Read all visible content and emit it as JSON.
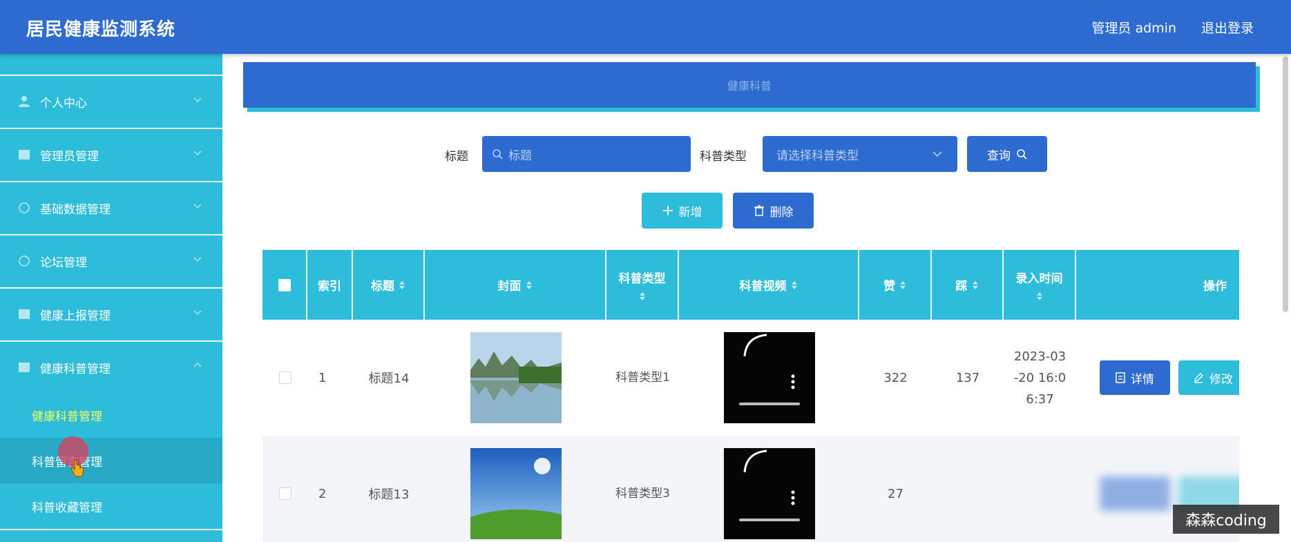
{
  "header": {
    "title": "居民健康监测系统",
    "user": "管理员 admin",
    "logout": "退出登录"
  },
  "sidebar": {
    "items": [
      {
        "label": "个人中心",
        "icon": "user-icon"
      },
      {
        "label": "管理员管理",
        "icon": "list-icon"
      },
      {
        "label": "基础数据管理",
        "icon": "circle-icon"
      },
      {
        "label": "论坛管理",
        "icon": "circle-icon"
      },
      {
        "label": "健康上报管理",
        "icon": "list-icon"
      },
      {
        "label": "健康科普管理",
        "icon": "list-icon",
        "expanded": true
      }
    ],
    "sub_items": [
      {
        "label": "健康科普管理",
        "active": true
      },
      {
        "label": "科普留言管理",
        "hovered": true
      },
      {
        "label": "科普收藏管理"
      }
    ]
  },
  "breadcrumb": {
    "current": "健康科普"
  },
  "search": {
    "title_label": "标题",
    "title_placeholder": "标题",
    "type_label": "科普类型",
    "type_placeholder": "请选择科普类型",
    "query_button": "查询"
  },
  "actions": {
    "add": "新增",
    "delete": "删除"
  },
  "table": {
    "columns": [
      "索引",
      "标题",
      "封面",
      "科普类型",
      "科普视频",
      "赞",
      "踩",
      "录入时间",
      "操作"
    ],
    "rows": [
      {
        "index": "1",
        "title": "标题14",
        "type": "科普类型1",
        "likes": "322",
        "dislikes": "137",
        "time": "2023-03-20 16:06:37"
      },
      {
        "index": "2",
        "title": "标题13",
        "type": "科普类型3",
        "likes": "27",
        "dislikes": "",
        "time": ""
      }
    ],
    "row_actions": {
      "detail": "详情",
      "edit": "修改"
    }
  },
  "watermark": "森森coding",
  "colors": {
    "primary": "#2d6bd1",
    "accent": "#2dbcd9",
    "active_menu_text": "#f2ff5c"
  }
}
